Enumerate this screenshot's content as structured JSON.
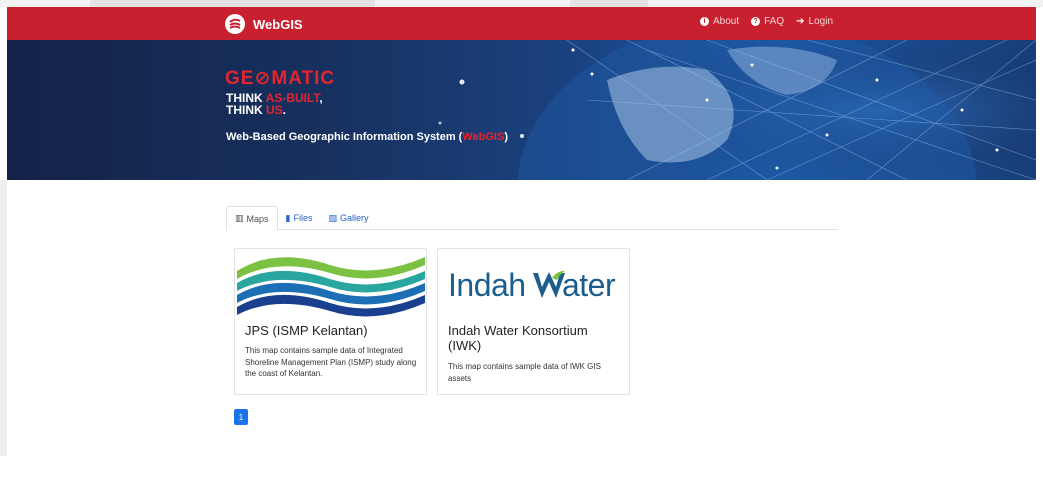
{
  "navbar": {
    "brand": "WebGIS",
    "brand_color": "#c8202f",
    "links": [
      {
        "label": "About",
        "icon": "info-icon"
      },
      {
        "label": "FAQ",
        "icon": "question-icon"
      },
      {
        "label": "Login",
        "icon": "sign-in-icon"
      }
    ]
  },
  "banner": {
    "logo_text": "GE⊘MATIC",
    "line1_prefix": "THINK ",
    "line1_highlight": "AS-BUILT",
    "line1_suffix": ",",
    "line2_prefix": "THINK ",
    "line2_highlight": "US",
    "line2_suffix": ".",
    "tagline_prefix": "Web-Based Geographic Information System (",
    "tagline_highlight": "WebGIS",
    "tagline_suffix": ")",
    "accent_color": "#e4252f"
  },
  "tabs": [
    {
      "label": "Maps",
      "icon": "map-icon",
      "active": true
    },
    {
      "label": "Files",
      "icon": "file-icon",
      "active": false
    },
    {
      "label": "Gallery",
      "icon": "images-icon",
      "active": false
    }
  ],
  "cards": [
    {
      "title": "JPS (ISMP Kelantan)",
      "description": "This map contains sample data of Integrated Shoreline Management Plan (ISMP) study along the coast of Kelantan.",
      "image": "jps-wave-logo"
    },
    {
      "title": "Indah Water Konsortium (IWK)",
      "description": "This map contains sample data of IWK GIS assets",
      "image": "indah-water-logo",
      "logo_text_1": "Indah",
      "logo_text_2": "ater"
    }
  ],
  "pagination": {
    "current": "1"
  }
}
